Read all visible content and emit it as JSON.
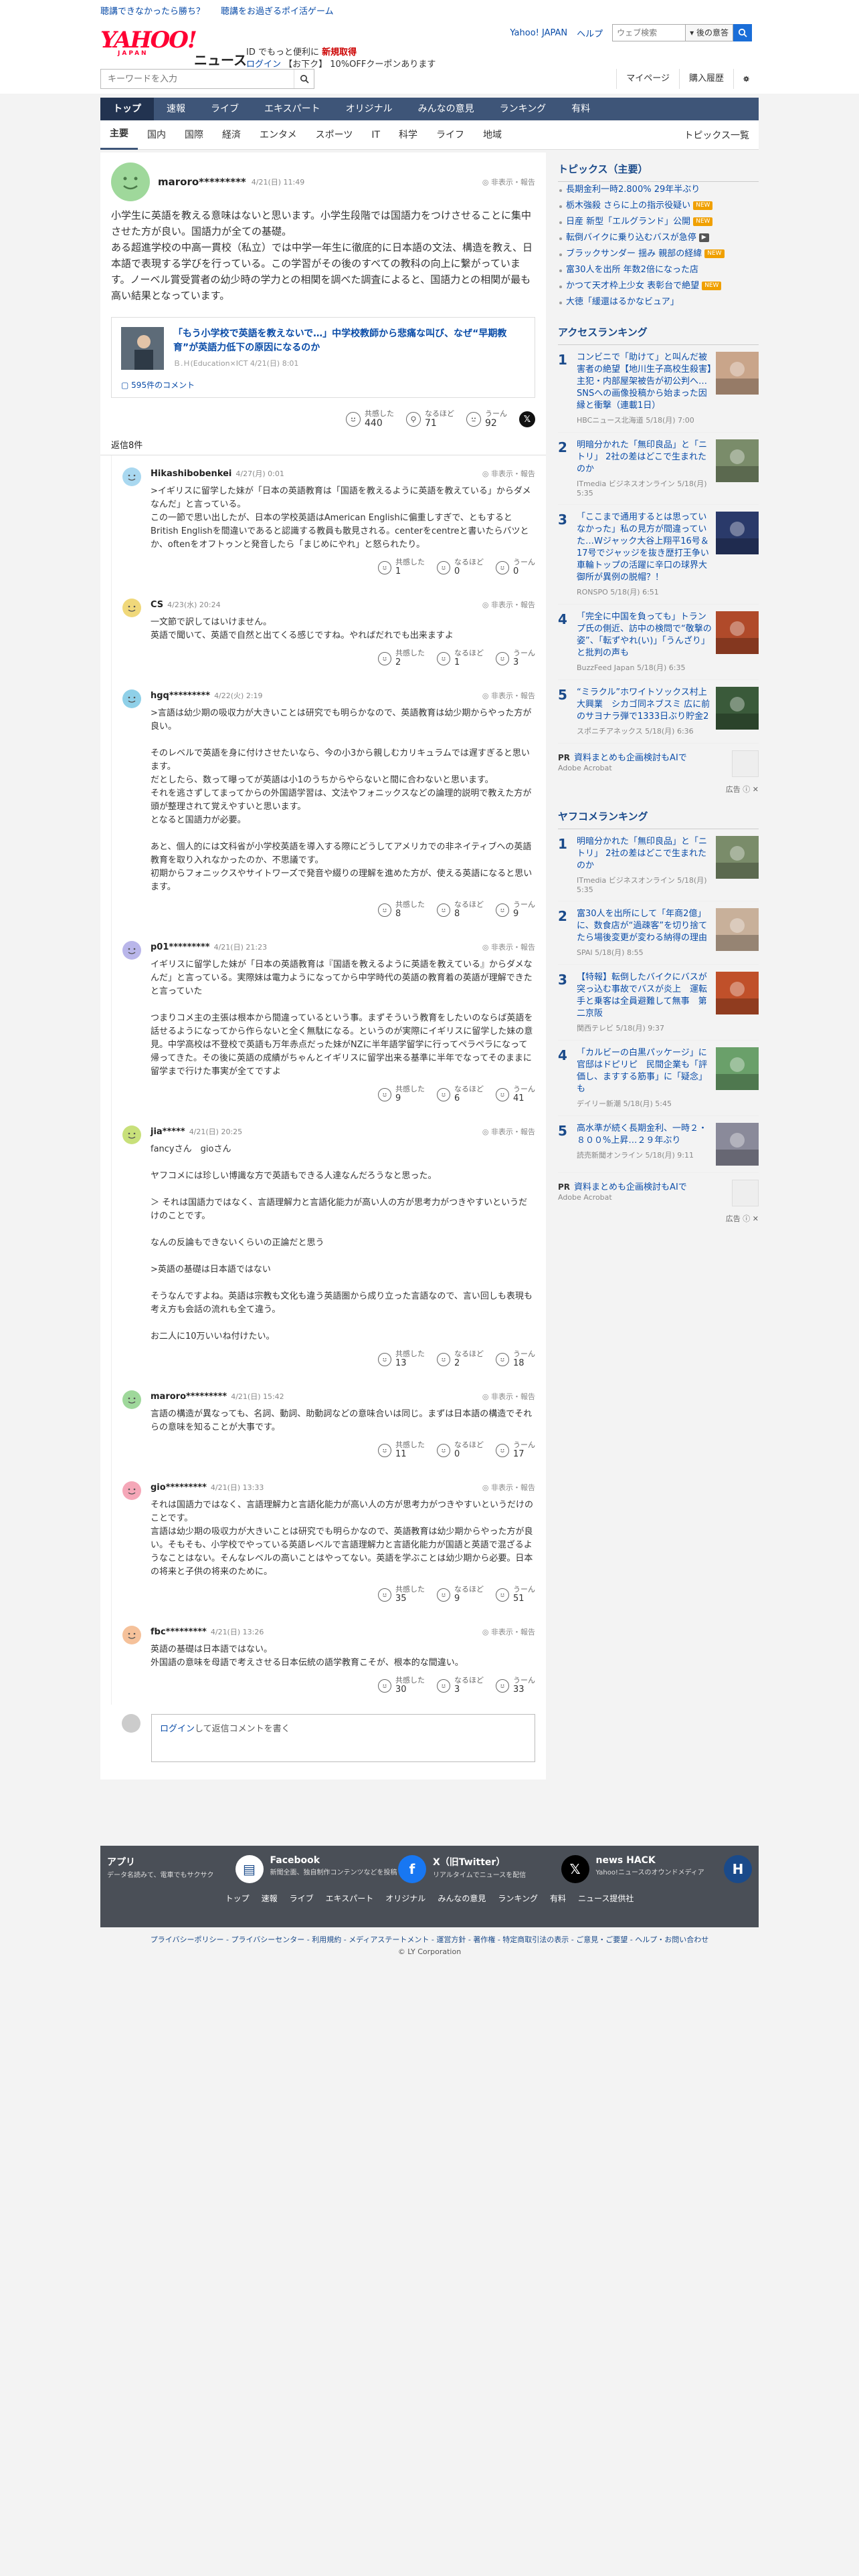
{
  "topstrip": {
    "item1": "聴講できなかったら勝ち？",
    "item2": "聴講をお過ぎるポイ活ゲーム"
  },
  "header": {
    "logo_text": "YAHOO!",
    "logo_sub": "JAPAN",
    "service": "ニュース",
    "promo_line1": "ID でもっと便利に",
    "promo_hl": "新規取得",
    "promo_login": "ログイン",
    "promo_line2": "【お下ク】 10%OFFクーポンあります",
    "links": [
      "Yahoo! JAPAN",
      "ヘルプ"
    ],
    "search_placeholder": "ウェブ検索",
    "search_btn": "▾ 後の意答"
  },
  "search": {
    "placeholder": "キーワードを入力",
    "links": [
      "マイページ",
      "購入履歴"
    ]
  },
  "nav": [
    "トップ",
    "速報",
    "ライブ",
    "エキスパート",
    "オリジナル",
    "みんなの意見",
    "ランキング",
    "有料"
  ],
  "subnav": [
    "主要",
    "国内",
    "国際",
    "経済",
    "エンタメ",
    "スポーツ",
    "IT",
    "科学",
    "ライフ",
    "地域"
  ],
  "subnav_more": "トピックス一覧",
  "post": {
    "user": "maroro*********",
    "date": "4/21(日) 11:49",
    "report": "非表示・報告",
    "body": "小学生に英語を教える意味はないと思います。小学生段階では国語力をつけさせることに集中させた方が良い。国語力が全ての基礎。\nある超進学校の中高一貫校（私立）では中学一年生に徹底的に日本語の文法、構造を教え、日本語で表現する学びを行っている。この学習がその後のすべての教科の向上に繋がっています。ノーベル賞受賞者の幼少時の学力との相関を調べた調査によると、国語力との相関が最も高い結果となっています。",
    "article_title": "「もう小学校で英語を教えないで…」中学校教師から悲痛な叫び、なぜ“早期教育”が英語力低下の原因になるのか",
    "article_src": "Ｂ.Ｈ(Education×ICT 4/21(日) 8:01",
    "comments": "595件のコメント",
    "reactions": {
      "kyokan_label": "共感した",
      "kyokan": "440",
      "naruhodo_label": "なるほど",
      "naruhodo": "71",
      "uun_label": "うーん",
      "uun": "92"
    }
  },
  "reply_header": "返信8件",
  "reply_labels": {
    "kyokan": "共感した",
    "naruhodo": "なるほど",
    "uun": "うーん"
  },
  "replies": [
    {
      "user": "Hikashibobenkei",
      "date": "4/27(月) 0:01",
      "report": "非表示・報告",
      "lines": [
        ">イギリスに留学した妹が「日本の英語教育は「国語を教えるように英語を教えている」からダメなんだ」と言っている。",
        "この一節で思い出したが、日本の学校英語はAmerican Englishに偏重しすぎで、ともするとBritish Englishを間違いであると認識する教員も散見される。centerをcentreと書いたらバツとか、oftenをオフトゥンと発音したら「まじめにやれ」と怒られたり。"
      ],
      "kyokan": "1",
      "naruhodo": "0",
      "uun": "0"
    },
    {
      "user": "CS",
      "date": "4/23(水) 20:24",
      "report": "非表示・報告",
      "lines": [
        "一文節で訳してはいけません。",
        "英語で聞いて、英語で自然と出てくる感じですね。やればだれでも出来ますよ"
      ],
      "kyokan": "2",
      "naruhodo": "1",
      "uun": "3"
    },
    {
      "user": "hgq*********",
      "date": "4/22(火) 2:19",
      "report": "非表示・報告",
      "lines": [
        ">言語は幼少期の吸収力が大きいことは研究でも明らかなので、英語教育は幼少期からやった方が良い。",
        "",
        "そのレベルで英語を身に付けさせたいなら、今の小3から親しむカリキュラムでは遅すぎると思います。",
        "だとしたら、数って曝ってが英語は小1のうちからやらないと間に合わないと思います。",
        "それを逃さずしてまってからの外国語学習は、文法やフォニックスなどの論理的説明で教えた方が頭が整理されて覚えやすいと思います。",
        "となると国語力が必要。",
        "",
        "あと、個人的には文科省が小学校英語を導入する際にどうしてアメリカでの非ネイティブへの英語教育を取り入れなかったのか、不思議です。",
        "初期からフォニックスやサイトワーズで発音や綴りの理解を進めた方が、使える英語になると思います。"
      ],
      "kyokan": "8",
      "naruhodo": "8",
      "uun": "9"
    },
    {
      "user": "p01*********",
      "date": "4/21(日) 21:23",
      "report": "非表示・報告",
      "lines": [
        "イギリスに留学した妹が「日本の英語教育は『国語を教えるように英語を教えている』からダメなんだ」と言っている。実際妹は電力ようになってから中学時代の英語の教育着の英語が理解できたと言っていた",
        "",
        "つまりコメ主の主張は根本から間違っているという事。まずそういう教育をしたいのならば英語を話せるようになってから作らないと全く無駄になる。というのが実際にイギリスに留学した妹の意見。中学高校は不登校で英語も万年赤点だった妹がNZに半年語学留学に行ってペラペラになって帰ってきた。その後に英語の成績がちゃんとイギリスに留学出来る基準に半年でなってそのままに留学まで行けた事実が全てですよ"
      ],
      "kyokan": "9",
      "naruhodo": "6",
      "uun": "41"
    },
    {
      "user": "jia*****",
      "date": "4/21(日) 20:25",
      "report": "非表示・報告",
      "lines": [
        "fancyさん　gioさん",
        "",
        "ヤフコメには珍しい博識な方で英語もできる人達なんだろうなと思った。",
        "",
        "＞ それは国語力ではなく、言語理解力と言語化能力が高い人の方が思考力がつきやすいというだけのことです。",
        "",
        "なんの反論もできないくらいの正論だと思う",
        "",
        ">英語の基礎は日本語ではない",
        "",
        "そうなんですよね。英語は宗教も文化も違う英語圏から成り立った言語なので、言い回しも表現も考え方も会話の流れも全て違う。",
        "",
        "お二人に10万いいね付けたい。"
      ],
      "kyokan": "13",
      "naruhodo": "2",
      "uun": "18"
    },
    {
      "user": "maroro*********",
      "date": "4/21(日) 15:42",
      "report": "非表示・報告",
      "lines": [
        "言語の構造が異なっても、名詞、動詞、助動詞などの意味合いは同じ。まずは日本語の構造でそれらの意味を知ることが大事です。"
      ],
      "kyokan": "11",
      "naruhodo": "0",
      "uun": "17"
    },
    {
      "user": "gio*********",
      "date": "4/21(日) 13:33",
      "report": "非表示・報告",
      "lines": [
        "それは国語力ではなく、言語理解力と言語化能力が高い人の方が思考力がつきやすいというだけのことです。",
        "言語は幼少期の吸収力が大きいことは研究でも明らかなので、英語教育は幼少期からやった方が良い。そもそも、小学校でやっている英語レベルで言語理解力と言語化能力が国語と英語で混ざるようなことはない。そんなレベルの高いことはやってない。英語を学ぶことは幼少期から必要。日本の将来と子供の将来のために。"
      ],
      "kyokan": "35",
      "naruhodo": "9",
      "uun": "51"
    },
    {
      "user": "fbc*********",
      "date": "4/21(日) 13:26",
      "report": "非表示・報告",
      "lines": [
        "英語の基礎は日本語ではない。",
        "外国語の意味を母語で考えさせる日本伝統の語学教育こそが、根本的な間違い。"
      ],
      "kyokan": "30",
      "naruhodo": "3",
      "uun": "33"
    }
  ],
  "compose": {
    "login": "ログイン",
    "text": "して返信コメントを書く"
  },
  "right": {
    "topics_title": "トピックス（主要）",
    "topics": [
      {
        "t": "長期金利一時2.800% 29年半ぶり",
        "tag": ""
      },
      {
        "t": "栃木強殺 さらに上の指示役疑い",
        "tag": "NEW"
      },
      {
        "t": "日産 新型「エルグランド」公開",
        "tag": "NEW"
      },
      {
        "t": "転倒バイクに乗り込むバスが急停",
        "tag": "▶"
      },
      {
        "t": "ブラックサンダー 揺み 親部の経緯",
        "tag": "NEW"
      },
      {
        "t": "富30人を出所 年数2倍になった店",
        "tag": ""
      },
      {
        "t": "かつて天才枠上少女 表彰台で絶望",
        "tag": "NEW"
      },
      {
        "t": "大徳「緩還はるかなビュア」",
        "tag": ""
      }
    ],
    "access_title": "アクセスランキング",
    "access": [
      {
        "no": "1",
        "t": "コンビニで「助けて」と叫んだ被害者の絶望【地川生子高校生殺害】主犯・内部屋架被告が初公判へ…SNSへの画像投稿から始まった因縁と衝撃（連載1日）",
        "s": "HBCニュース北海道 5/18(月) 7:00",
        "c": "#c9a58a"
      },
      {
        "no": "2",
        "t": "明暗分かれた「無印良品」と「ニトリ」 2社の差はどこで生まれたのか",
        "s": "ITmedia ビジネスオンライン 5/18(月) 5:35",
        "c": "#7a8c6a"
      },
      {
        "no": "3",
        "t": "「ここまで通用するとは思っていなかった」私の見方が間違っていた…Wジャック大谷上翔平16号＆17号でジャッジを抜き歴打王争い 車輪トップの活躍に辛口の球界大御所が異例の脱帽？！",
        "s": "RONSPO 5/18(月) 6:51",
        "c": "#2a3a6a"
      },
      {
        "no": "4",
        "t": "「完全に中国を負っても」トランプ氏の側近、訪中の検問で“敬撃の姿”、「転ずやれ(い)」「うんざり」と批判の声も",
        "s": "BuzzFeed Japan 5/18(月) 6:35",
        "c": "#b04a2a"
      },
      {
        "no": "5",
        "t": "“ミラクル”ホワイトソックス村上大興業　シカゴ同ネブスミ 広に前のサヨナラ弾で1333日ぶり貯金2",
        "s": "スポニチアネックス 5/18(月) 6:36",
        "c": "#3a5a3a"
      }
    ],
    "pr1": {
      "p": "PR",
      "t": "資料まとめも企画検討もAIで",
      "s": "Adobe Acrobat"
    },
    "pr1_ad": "広告 ⓘ ✕",
    "yafoo_title": "ヤフコメランキング",
    "yafoo": [
      {
        "no": "1",
        "t": "明暗分かれた「無印良品」と「ニトリ」 2社の差はどこで生まれたのか",
        "s": "ITmedia ビジネスオンライン 5/18(月) 5:35",
        "c": "#7a8c6a"
      },
      {
        "no": "2",
        "t": "富30人を出所にして「年商2億」に、数食店が“過疎客”を切り捨てたら場後変更が変わる納得の理由",
        "s": "SPAI 5/18(月) 8:55",
        "c": "#c8b09a"
      },
      {
        "no": "3",
        "t": "【特報】転倒したバイクにバスが突っ込む事故でバスが炎上　運転手と乗客は全員避難して無事　第二京阪",
        "s": "関西テレビ 5/18(月) 9:37",
        "c": "#c0502a"
      },
      {
        "no": "4",
        "t": "「カルビーの白黒パッケージ」に官邸はドピリピ　民間企業も「評価し、ますする筋事」に「疑念」も",
        "s": "デイリー新潮 5/18(月) 5:45",
        "c": "#6aa06a"
      },
      {
        "no": "5",
        "t": "高水準が続く長期金利、一時２・８００%上昇…２９年ぶり",
        "s": "読売新聞オンライン 5/18(月) 9:11",
        "c": "#8a8a9a"
      }
    ],
    "pr2": {
      "p": "PR",
      "t": "資料まとめも企画検討もAIで",
      "s": "Adobe Acrobat"
    },
    "pr2_ad": "広告 ⓘ ✕"
  },
  "footer": {
    "cols": [
      {
        "h": "アプリ",
        "d": "データ名読みて、電車でもサクサク",
        "c": "#fff"
      },
      {
        "h": "Facebook",
        "d": "新聞全面、独自制作コンテンツなどを投稿",
        "c": "#1877f2"
      },
      {
        "h": "X（旧Twitter）",
        "d": "リアルタイムでニュースを配信",
        "c": "#000"
      },
      {
        "h": "news HACK",
        "d": "Yahoo!ニュースのオウンドメディア",
        "c": "#1a4a8a"
      }
    ],
    "nav": [
      "トップ",
      "速報",
      "ライブ",
      "エキスパート",
      "オリジナル",
      "みんなの意見",
      "ランキング",
      "有料",
      "ニュース提供社"
    ],
    "links": "プライバシーポリシー - プライバシーセンター - 利用規約 - メディアステートメント - 運営方針 - 著作権 - 特定商取引法の表示 - ご意見・ご要望 - ヘルプ・お問い合わせ",
    "copy": "© LY Corporation"
  },
  "colors": {
    "nav": "#3e5578",
    "link": "#0a4ca8",
    "accent": "#ff0033"
  }
}
